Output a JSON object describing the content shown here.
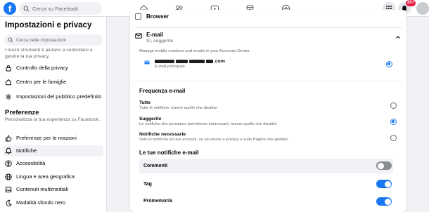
{
  "header": {
    "logo_letter": "f",
    "search_placeholder": "Cerca su Facebook",
    "nav_icons": [
      "home-icon",
      "friends-icon",
      "video-icon",
      "marketplace-icon",
      "groups-icon"
    ],
    "right_icons": [
      "menu-grid-icon",
      "notifications-bell-icon",
      "profile-avatar"
    ],
    "notification_badge": "20+"
  },
  "sidebar": {
    "title": "Impostazioni e privacy",
    "search_placeholder": "Cerca nelle impostazioni",
    "description": "I nostri strumenti ti aiutano a controllare e gestire la tua privacy.",
    "items_privacy": [
      {
        "label": "Controllo della privacy",
        "icon": "lock-icon"
      },
      {
        "label": "Centro per le famiglie",
        "icon": "home-icon"
      },
      {
        "label": "Impostazioni del pubblico predefinito",
        "icon": "settings-gear-icon"
      }
    ],
    "preferences_heading": "Preferenze",
    "preferences_description": "Personalizza la tua esperienza su Facebook.",
    "items_prefs": [
      {
        "label": "Preferenze per le reazioni",
        "icon": "thumbs-up-icon"
      },
      {
        "label": "Notifiche",
        "icon": "bell-icon",
        "active": true
      },
      {
        "label": "Accessibilità",
        "icon": "accessibility-icon"
      },
      {
        "label": "Lingua e area geografica",
        "icon": "globe-icon"
      },
      {
        "label": "Contenuti multimediali",
        "icon": "media-icon"
      },
      {
        "label": "Modalità sfondo nero",
        "icon": "moon-icon"
      }
    ]
  },
  "main": {
    "browser_label": "Browser",
    "email_title": "E-mail",
    "email_subtitle": "Sì, suggerite",
    "manage_text": "Manage mobile numbers and emails in your Accounts Center.",
    "address_domain": ".com",
    "address_caption": "E-mail principale",
    "frequency_title": "Frequenza e-mail",
    "frequency_options": [
      {
        "title": "Tutte",
        "desc": "Tutte le notifiche, tranne quelle che disattivi",
        "selected": false
      },
      {
        "title": "Suggerite",
        "desc": "Le notifiche che pensiamo potrebbero interessarti, tranne quelle che disattivi",
        "selected": true
      },
      {
        "title": "Notifiche necessarie",
        "desc": "Solo le notifiche sul tuo account, su sicurezza e privacy e sulle Pagine che gestisci",
        "selected": false
      }
    ],
    "your_notifications_title": "Le tue notifiche e-mail",
    "notification_toggles": [
      {
        "label": "Commenti",
        "on": false
      },
      {
        "label": "Tag",
        "on": true
      },
      {
        "label": "Promemoria",
        "on": true
      }
    ]
  },
  "colors": {
    "accent": "#1877f2",
    "background": "#f0f2f5",
    "text_secondary": "#65676b",
    "badge": "#e41e3f"
  }
}
